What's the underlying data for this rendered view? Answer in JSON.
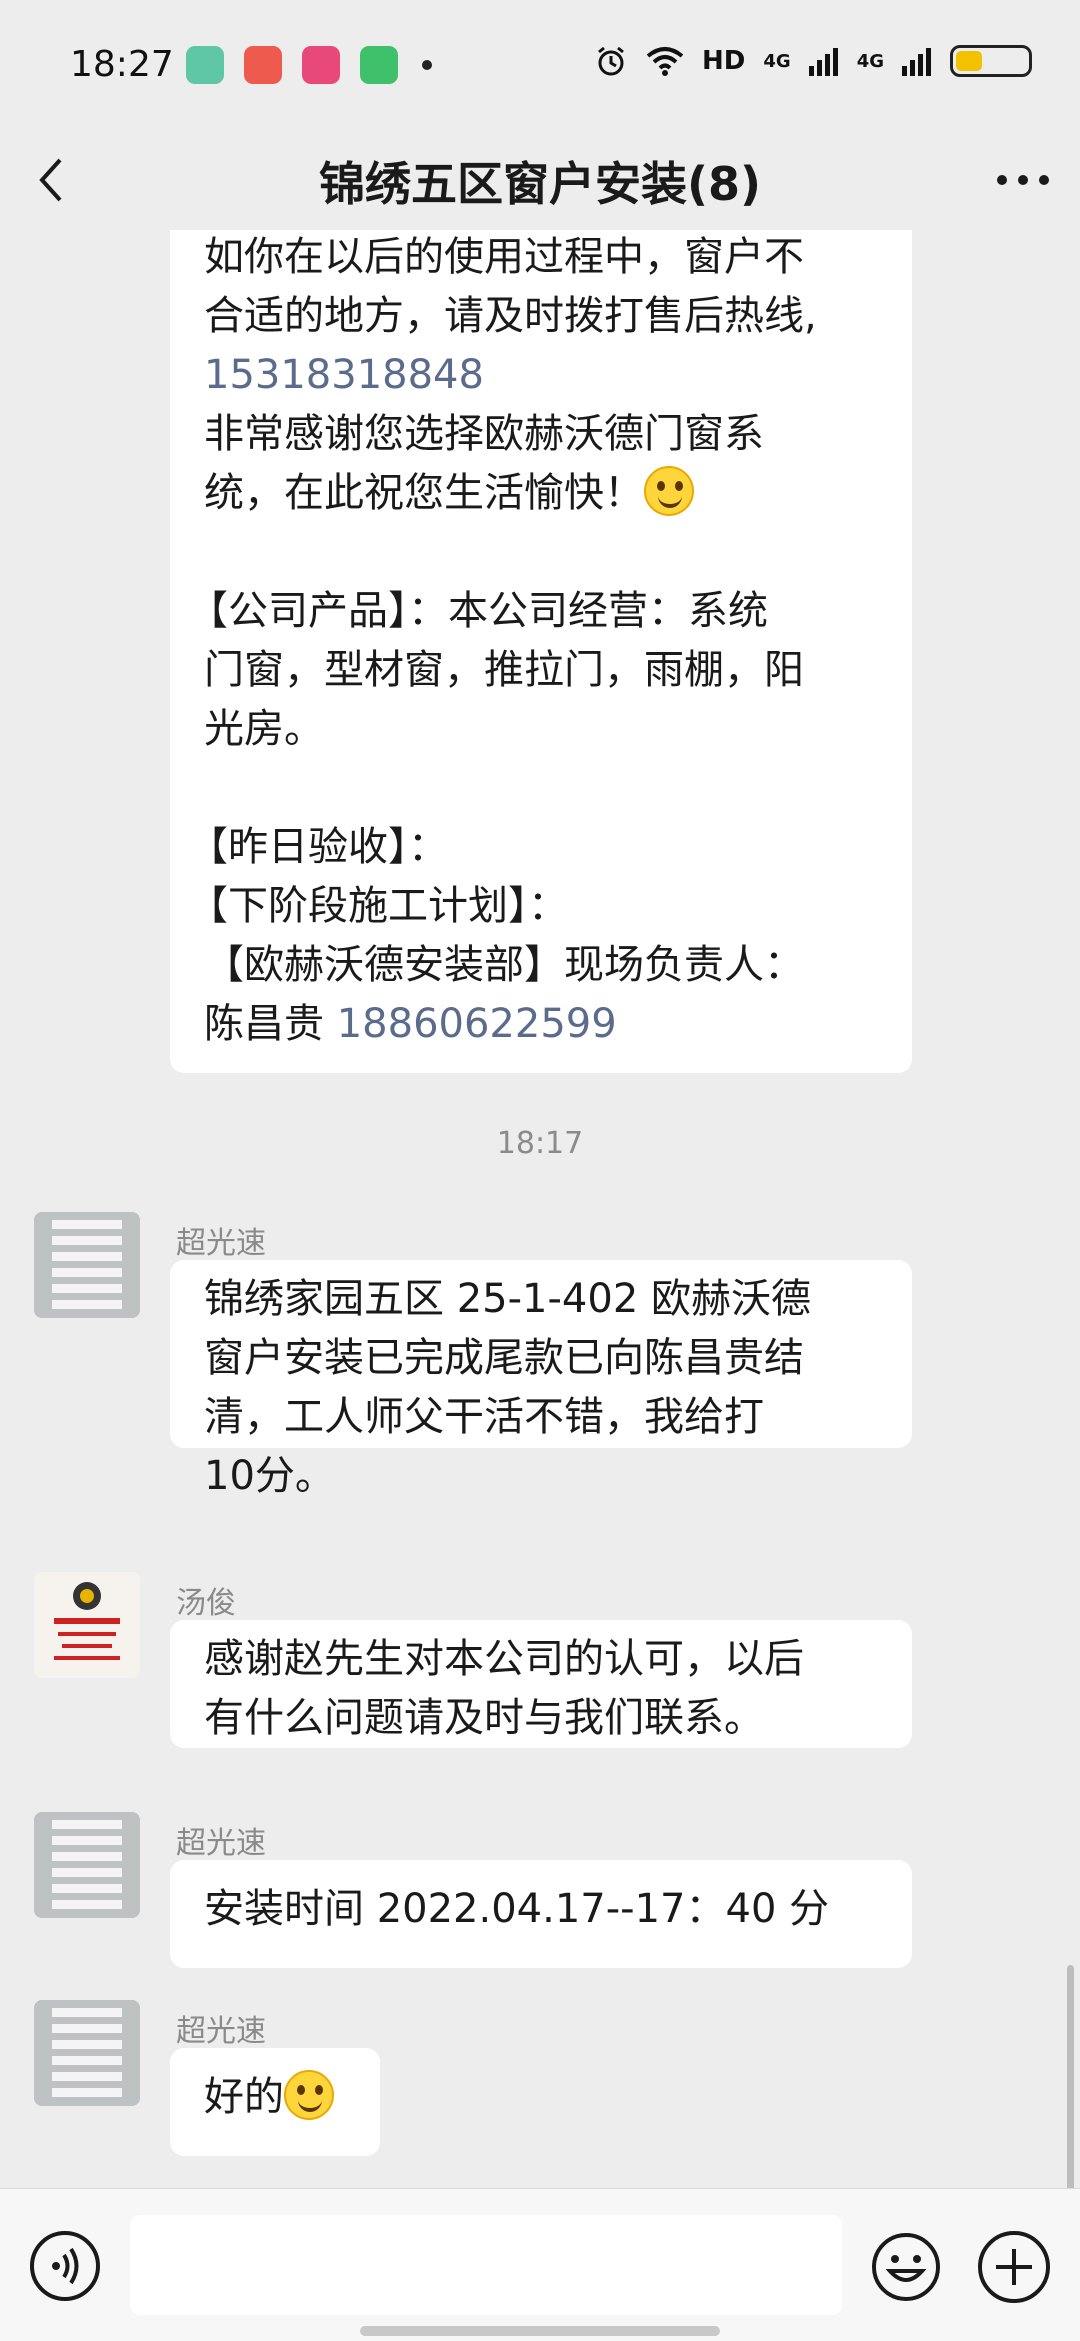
{
  "status_bar": {
    "time": "18:27",
    "network": "HD",
    "signal_1": "4G",
    "signal_2": "4G",
    "notification_icons": [
      "app-green-icon",
      "app-red-icon",
      "app-pink-icon",
      "app-green-small-icon"
    ]
  },
  "header": {
    "title": "锦绣五区窗户安装(8)",
    "back_icon": "back-chevron-icon",
    "more_icon": "more-dots-icon"
  },
  "messages": {
    "m1": {
      "line1": "如你在以后的使用过程中，窗户不",
      "line2": "合适的地方，请及时拨打售后热线,",
      "phone1": "15318318848",
      "line4": "  非常感谢您选择欧赫沃德门窗系",
      "line5": "统，在此祝您生活愉快！",
      "line6": "【公司产品】：本公司经营：系统",
      "line7": "门窗，型材窗，推拉门，雨棚，阳",
      "line8": "光房。",
      "line9": "【昨日验收】：",
      "line10": "【下阶段施工计划】：",
      "line11": " 【欧赫沃德安装部】现场负责人：",
      "line12_text": "陈昌贵 ",
      "phone2": "18860622599"
    },
    "timestamp": "18:17",
    "m2": {
      "sender": "超光速",
      "text": "锦绣家园五区 25-1-402 欧赫沃德\n窗户安装已完成尾款已向陈昌贵结\n清，工人师父干活不错，我给打\n10分。"
    },
    "m3": {
      "sender": "汤俊",
      "text": "感谢赵先生对本公司的认可，以后\n有什么问题请及时与我们联系。",
      "avatar_text": "欧赫·沃德"
    },
    "m4": {
      "sender": "超光速",
      "text": "安装时间 2022.04.17--17：40 分"
    },
    "m5": {
      "sender": "超光速",
      "text": "好的"
    }
  },
  "input_bar": {
    "voice_icon": "voice-icon",
    "emoji_icon": "emoji-icon",
    "plus_icon": "plus-icon",
    "text_value": ""
  },
  "colors": {
    "background": "#ededed",
    "bubble": "#ffffff",
    "phone_link": "#5b6b8c",
    "timestamp": "#8b8b8b",
    "battery": "#f2c100"
  }
}
